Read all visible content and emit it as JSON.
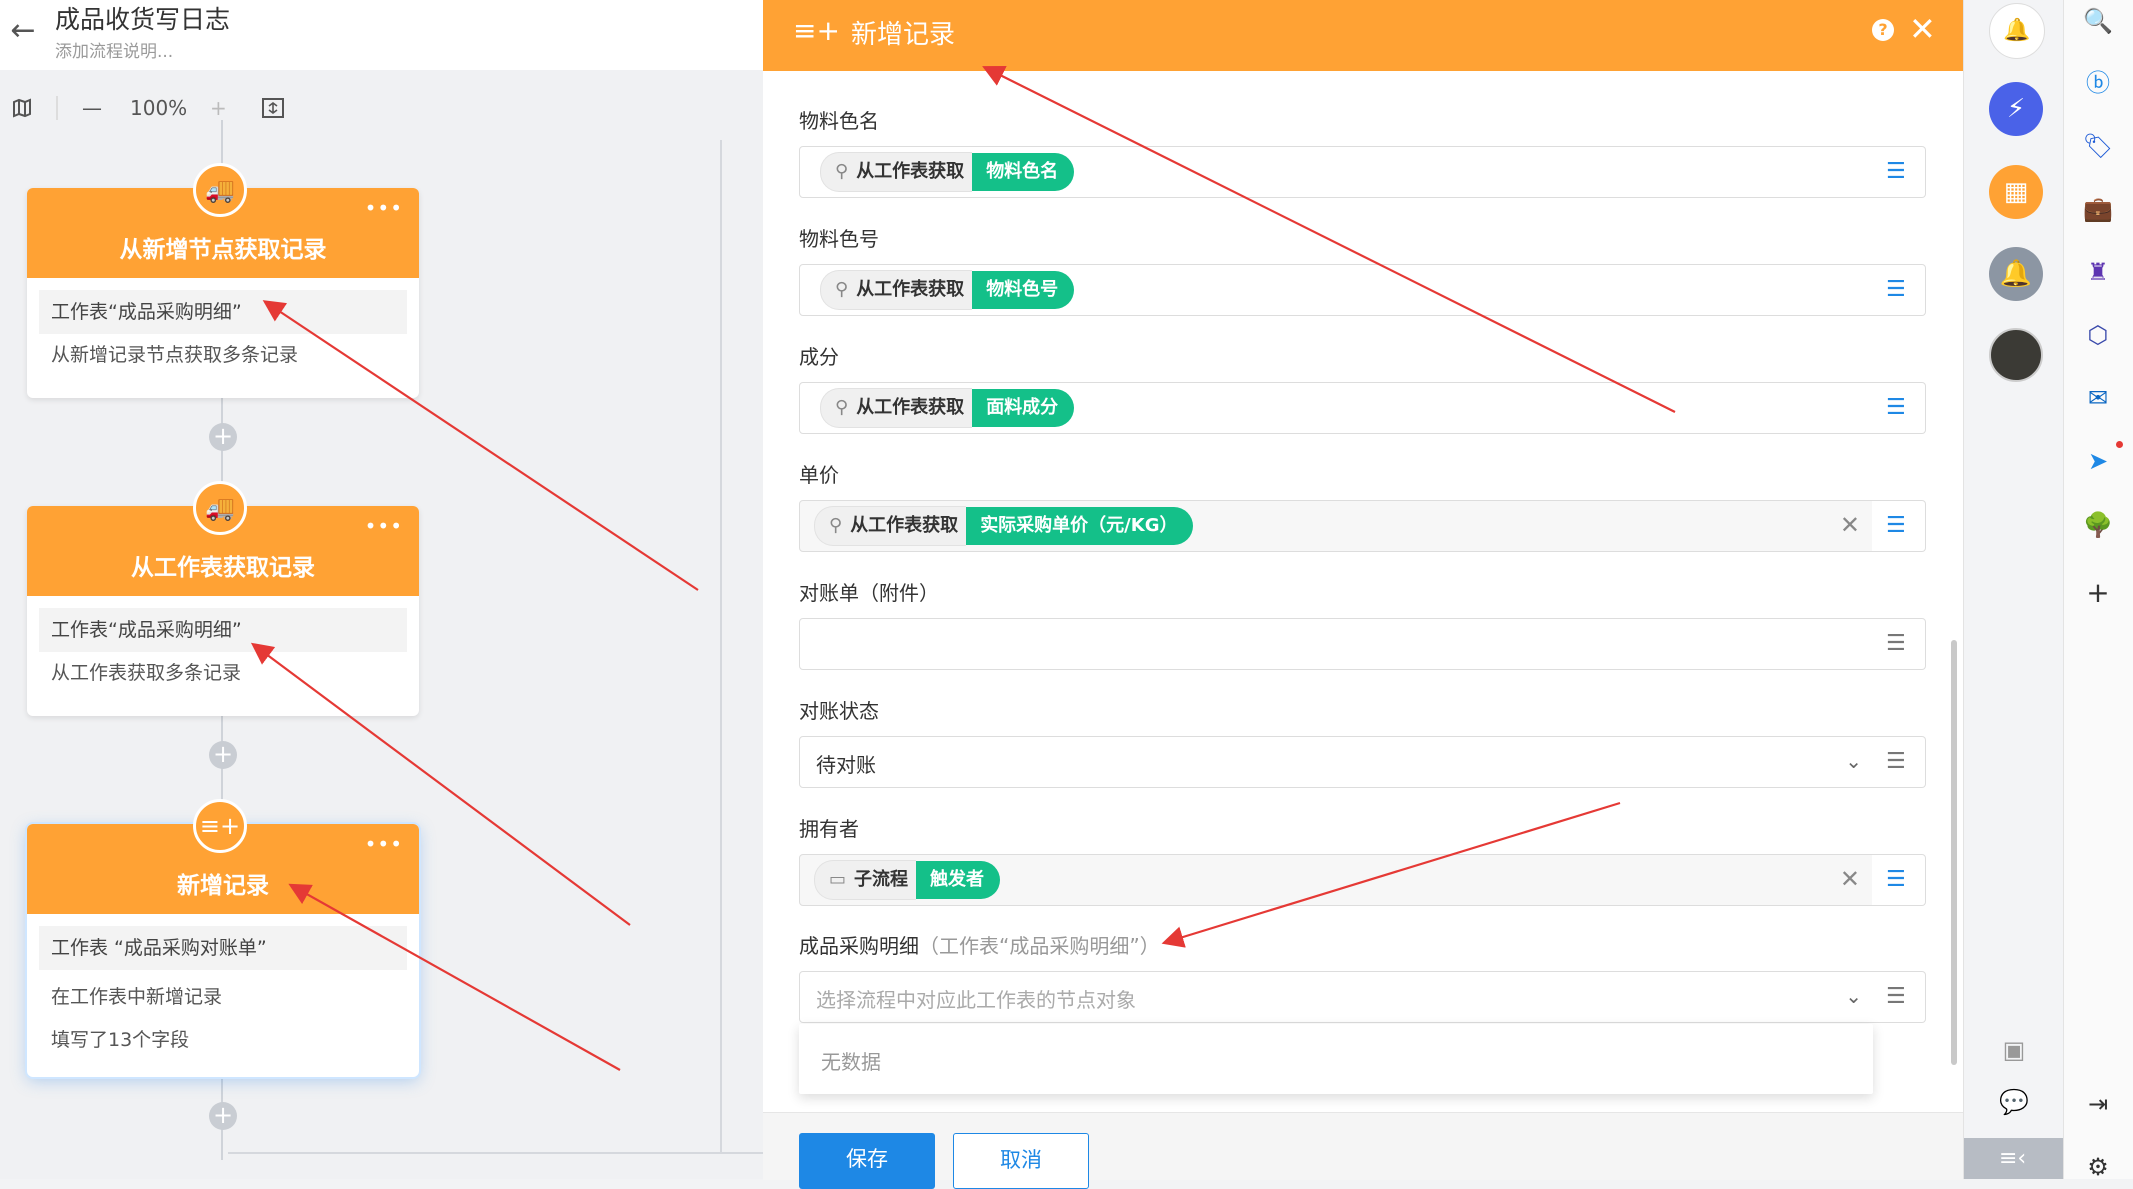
{
  "header": {
    "title": "成品收货写日志",
    "description": "添加流程说明..."
  },
  "toolbar": {
    "zoom": "100%"
  },
  "nodes": [
    {
      "title": "从新增节点获取记录",
      "sheet": "工作表“成品采购明细”",
      "line1": "从新增记录节点获取多条记录",
      "line2": ""
    },
    {
      "title": "从工作表获取记录",
      "sheet": "工作表“成品采购明细”",
      "line1": "从工作表获取多条记录",
      "line2": ""
    },
    {
      "title": "新增记录",
      "sheet": "工作表 “成品采购对账单”",
      "line1": "在工作表中新增记录",
      "line2": "填写了13个字段"
    }
  ],
  "dialog": {
    "title": "新增记录",
    "fields": [
      {
        "label": "物料色名",
        "source": "从工作表获取",
        "value": "物料色名"
      },
      {
        "label": "物料色号",
        "source": "从工作表获取",
        "value": "物料色号"
      },
      {
        "label": "成分",
        "source": "从工作表获取",
        "value": "面料成分"
      },
      {
        "label": "单价",
        "source": "从工作表获取",
        "value": "实际采购单价（元/KG）"
      },
      {
        "label": "对账单（附件）"
      },
      {
        "label": "对账状态",
        "value": "待对账"
      },
      {
        "label": "拥有者",
        "source": "子流程",
        "value": "触发者"
      },
      {
        "label": "成品采购明细",
        "hint": "（工作表“成品采购明细”）",
        "placeholder": "选择流程中对应此工作表的节点对象"
      }
    ],
    "dropdown_empty": "无数据",
    "save_label": "保存",
    "cancel_label": "取消"
  },
  "colors": {
    "accent": "#ffa234",
    "primary": "#1e88e5",
    "tag_green": "#14c089",
    "arrow": "#e53935"
  }
}
